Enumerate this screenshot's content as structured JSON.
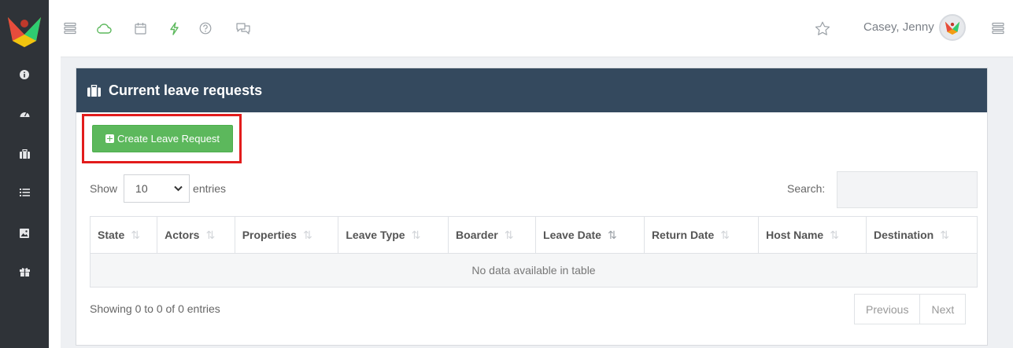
{
  "header": {
    "user_name": "Casey, Jenny",
    "icons": [
      "menu-icon",
      "cloud-icon",
      "calendar-icon",
      "bolt-icon",
      "help-icon",
      "chat-icon",
      "star-icon",
      "menu-icon"
    ]
  },
  "sidebar": {
    "icons": [
      "info-icon",
      "dashboard-icon",
      "briefcase-icon",
      "list-icon",
      "image-icon",
      "gift-icon"
    ]
  },
  "panel": {
    "title": "Current leave requests",
    "create_label": "Create Leave Request"
  },
  "table": {
    "show_label": "Show",
    "length_value": "10",
    "entries_label": "entries",
    "search_label": "Search:",
    "columns": [
      "State",
      "Actors",
      "Properties",
      "Leave Type",
      "Boarder",
      "Leave Date",
      "Return Date",
      "Host Name",
      "Destination"
    ],
    "empty_message": "No data available in table",
    "info": "Showing 0 to 0 of 0 entries",
    "prev_label": "Previous",
    "next_label": "Next"
  },
  "colors": {
    "sidebar": "#2f3338",
    "panel_header": "#34495e",
    "create_button": "#5cb85c",
    "highlight": "#e21c1c"
  }
}
